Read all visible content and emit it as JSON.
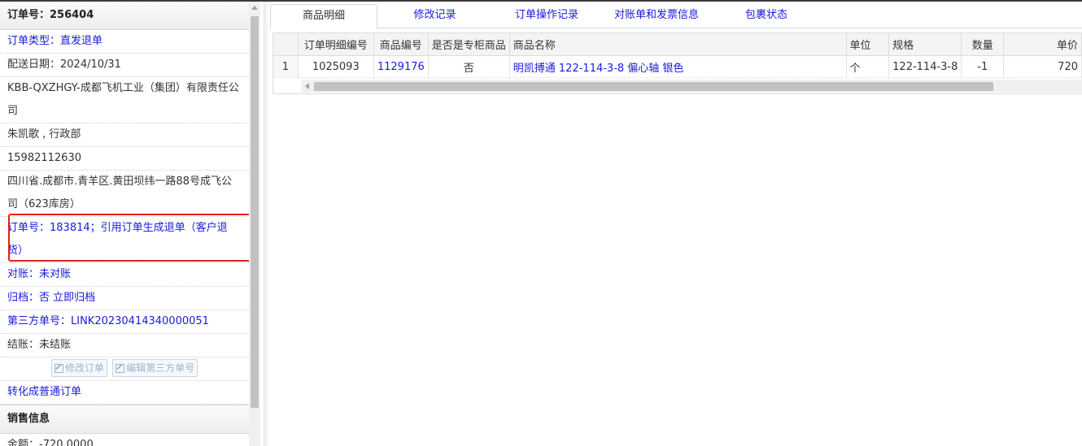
{
  "order_panel": {
    "title": "订单号：256404",
    "rows": [
      "订单类型：直发退单",
      "配送日期：2024/10/31",
      "KBB-QXZHGY-成都飞机工业（集团）有限责任公司",
      "朱凯歌 , 行政部",
      "15982112630",
      "四川省.成都市.青羊区.黄田坝纬一路88号成飞公司（623库房）",
      "订单号：183814；引用订单生成退单（客户退货）",
      "对账：未对账",
      "归档：否 立即归档",
      "第三方单号：LINK20230414340000051",
      "结账：未结账"
    ],
    "edit_order_label": "修改订单",
    "edit_third_party_label": "编辑第三方单号",
    "convert_label": "转化成普通订单"
  },
  "sales_panel": {
    "title": "销售信息",
    "amount": "金额：-720.0000"
  },
  "tabs": [
    "商品明细",
    "修改记录",
    "订单操作记录",
    "对账单和发票信息",
    "包裹状态"
  ],
  "active_tab": "商品明细",
  "table": {
    "columns": [
      "订单明细编号",
      "商品编号",
      "是否是专柜商品",
      "商品名称",
      "单位",
      "规格",
      "数量",
      "单价"
    ],
    "rows": [
      {
        "index": "1",
        "detail_no": "1025093",
        "product_no": "1129176",
        "is_counter": "否",
        "name": "明凯搏通 122-114-3-8 偏心轴 银色",
        "unit": "个",
        "spec": "122-114-3-8",
        "qty": "-1",
        "price": "720"
      }
    ]
  }
}
